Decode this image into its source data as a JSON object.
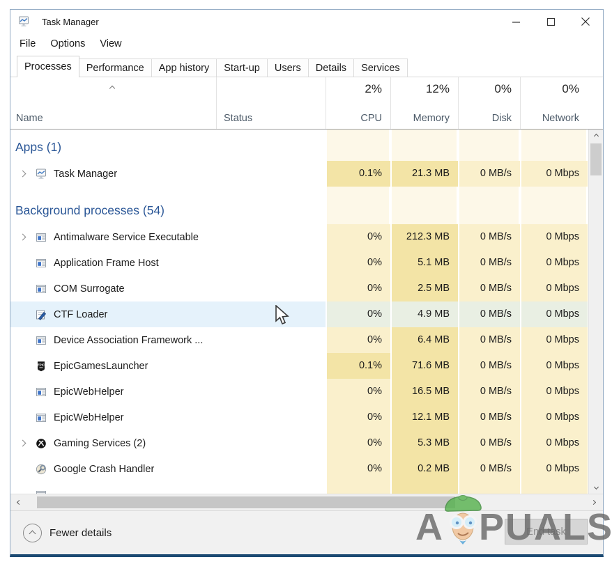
{
  "window": {
    "title": "Task Manager"
  },
  "menu": {
    "items": [
      "File",
      "Options",
      "View"
    ]
  },
  "tabs": [
    {
      "label": "Processes",
      "active": true
    },
    {
      "label": "Performance"
    },
    {
      "label": "App history"
    },
    {
      "label": "Start-up"
    },
    {
      "label": "Users"
    },
    {
      "label": "Details"
    },
    {
      "label": "Services"
    }
  ],
  "header": {
    "name_label": "Name",
    "status_label": "Status",
    "usage": [
      {
        "label": "CPU",
        "total": "2%"
      },
      {
        "label": "Memory",
        "total": "12%"
      },
      {
        "label": "Disk",
        "total": "0%"
      },
      {
        "label": "Network",
        "total": "0%"
      }
    ]
  },
  "groups": [
    {
      "label": "Apps (1)",
      "rows": [
        {
          "name": "Task Manager",
          "icon": "task-manager",
          "expandable": true,
          "hovered": false,
          "values": [
            "0.1%",
            "21.3 MB",
            "0 MB/s",
            "0 Mbps"
          ],
          "heat": [
            2,
            2,
            1,
            1
          ]
        }
      ]
    },
    {
      "label": "Background processes (54)",
      "rows": [
        {
          "name": "Antimalware Service Executable",
          "icon": "default-app",
          "expandable": true,
          "hovered": false,
          "values": [
            "0%",
            "212.3 MB",
            "0 MB/s",
            "0 Mbps"
          ],
          "heat": [
            1,
            2,
            1,
            1
          ]
        },
        {
          "name": "Application Frame Host",
          "icon": "default-app",
          "expandable": false,
          "hovered": false,
          "values": [
            "0%",
            "5.1 MB",
            "0 MB/s",
            "0 Mbps"
          ],
          "heat": [
            1,
            2,
            1,
            1
          ]
        },
        {
          "name": "COM Surrogate",
          "icon": "default-app",
          "expandable": false,
          "hovered": false,
          "values": [
            "0%",
            "2.5 MB",
            "0 MB/s",
            "0 Mbps"
          ],
          "heat": [
            1,
            2,
            1,
            1
          ]
        },
        {
          "name": "CTF Loader",
          "icon": "ctf-loader",
          "expandable": false,
          "hovered": true,
          "values": [
            "0%",
            "4.9 MB",
            "0 MB/s",
            "0 Mbps"
          ],
          "heat": [
            1,
            2,
            1,
            1
          ]
        },
        {
          "name": "Device Association Framework ...",
          "icon": "default-app",
          "expandable": false,
          "hovered": false,
          "values": [
            "0%",
            "6.4 MB",
            "0 MB/s",
            "0 Mbps"
          ],
          "heat": [
            1,
            2,
            1,
            1
          ]
        },
        {
          "name": "EpicGamesLauncher",
          "icon": "epic-games",
          "expandable": false,
          "hovered": false,
          "values": [
            "0.1%",
            "71.6 MB",
            "0 MB/s",
            "0 Mbps"
          ],
          "heat": [
            2,
            2,
            1,
            1
          ]
        },
        {
          "name": "EpicWebHelper",
          "icon": "default-app",
          "expandable": false,
          "hovered": false,
          "values": [
            "0%",
            "16.5 MB",
            "0 MB/s",
            "0 Mbps"
          ],
          "heat": [
            1,
            2,
            1,
            1
          ]
        },
        {
          "name": "EpicWebHelper",
          "icon": "default-app",
          "expandable": false,
          "hovered": false,
          "values": [
            "0%",
            "12.1 MB",
            "0 MB/s",
            "0 Mbps"
          ],
          "heat": [
            1,
            2,
            1,
            1
          ]
        },
        {
          "name": "Gaming Services (2)",
          "icon": "xbox",
          "expandable": true,
          "hovered": false,
          "values": [
            "0%",
            "5.3 MB",
            "0 MB/s",
            "0 Mbps"
          ],
          "heat": [
            1,
            2,
            1,
            1
          ]
        },
        {
          "name": "Google Crash Handler",
          "icon": "google-crash",
          "expandable": false,
          "hovered": false,
          "values": [
            "0%",
            "0.2 MB",
            "0 MB/s",
            "0 Mbps"
          ],
          "heat": [
            1,
            2,
            1,
            1
          ]
        }
      ]
    }
  ],
  "partial_row": {
    "icon": "default-app",
    "heat": [
      1,
      2,
      1,
      1
    ]
  },
  "footer": {
    "fewer_details": "Fewer details",
    "end_task": "End task"
  },
  "watermark": {
    "prefix": "A",
    "suffix": "PUALS"
  },
  "colors": {
    "group_header_text": "#2b5797",
    "heat_low": "#faf0cc",
    "heat_mid": "#f3e4a6",
    "heat_base": "#fdf8e8",
    "hover_row": "#e5f2fb",
    "window_bottom_border": "#1c4a72"
  }
}
